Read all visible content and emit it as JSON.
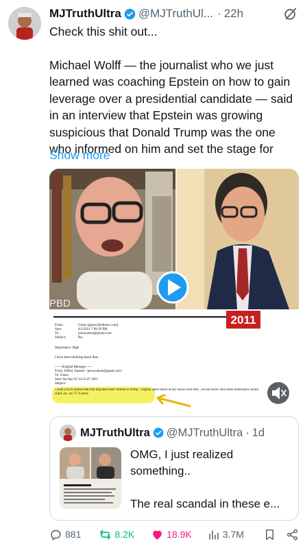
{
  "post": {
    "author_name": "MJTruthUltra",
    "author_handle": "@MJTruthUl...",
    "separator": "·",
    "time": "22h",
    "line1": "Check this shit out...",
    "body": "Michael Wolff — the journalist who we just learned was coaching Epstein on how to gain leverage over a presidential candidate — said in an interview that Epstein was growing suspicious that Donald Trump was the one who informed on him and set the stage for",
    "show_more": "Show more"
  },
  "media": {
    "watermark": "PBD",
    "year_badge": "2011",
    "email": {
      "fields": [
        {
          "k": "From:",
          "v": "Gmax [gmax1@ellmax.com]"
        },
        {
          "k": "Sent:",
          "v": "4/2/2011 7:09:39 PM"
        },
        {
          "k": "To:",
          "v": "jeevacation@gmail.com"
        },
        {
          "k": "Subject:",
          "v": "Re:"
        }
      ],
      "importance": "Importance:  High",
      "line_a": "I have been thinking about that...",
      "orig": "----- Original Message -----",
      "from2": "From: Jeffrey Epstein <jeevacation@gmail.com>",
      "to2": "To: Gmax",
      "sent2": "Sent: Sat Apr 02 14:25:47 2011",
      "subj2": "Subject:",
      "quote": "i want you to realize that that dog that hasn't barked is trump.. virginia spent hours at my house with him ,, he has never once been mentioned. police chief. etc. im 75 % there"
    },
    "colors": {
      "highlight": "#f4ee3a",
      "accent": "#c8201f",
      "play": "#1d9bf0"
    }
  },
  "quote_tweet": {
    "author_name": "MJTruthUltra",
    "author_handle": "@MJTruthUltra",
    "separator": "·",
    "time": "1d",
    "line1": "OMG, I just realized something..",
    "line2": "The real scandal in these e..."
  },
  "actions": {
    "replies": "881",
    "reposts": "8.2K",
    "likes": "18.9K",
    "views": "3.7M"
  }
}
